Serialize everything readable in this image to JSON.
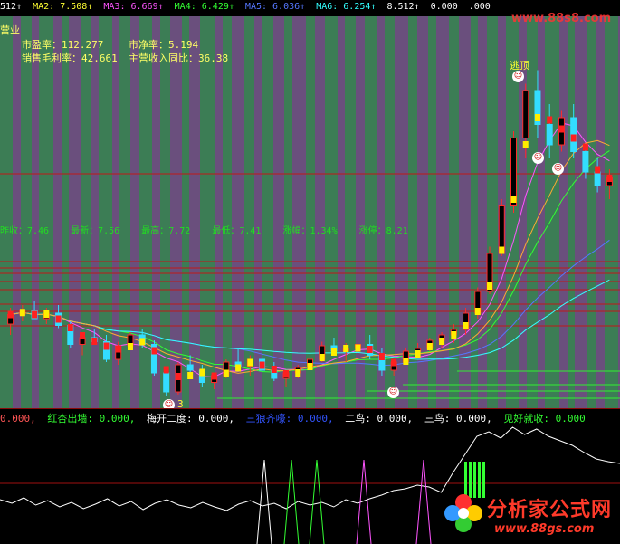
{
  "ma_row": [
    {
      "text": "512↑",
      "color": "#ffffff"
    },
    {
      "text": "MA2: 7.508↑",
      "color": "#ffff33"
    },
    {
      "text": "MA3: 6.669↑",
      "color": "#ff55ff"
    },
    {
      "text": "MA4: 6.429↑",
      "color": "#33ff33"
    },
    {
      "text": "MA5: 6.036↑",
      "color": "#5577ff"
    },
    {
      "text": "MA6: 6.254↑",
      "color": "#33ffff"
    },
    {
      "text": "8.512↑",
      "color": "#ffffff"
    },
    {
      "text": "0.000",
      "color": "#ffffff"
    },
    {
      "text": ".000",
      "color": "#ffffff"
    }
  ],
  "header_label": "营业",
  "info": {
    "pe": "市盈率：112.277",
    "pb": "市净率：5.194",
    "margin": "销售毛利率：42.661",
    "revenue_yoy": "主营收入同比：36.38"
  },
  "stats": {
    "prev_close": "昨收：7.46",
    "latest": "最新：7.56",
    "high": "最高：7.72",
    "low": "最低：7.41",
    "change": "涨幅：1.34%",
    "limit_up": "涨停：8.21"
  },
  "tip_label": "逃顶",
  "face_label": "3",
  "signals": [
    {
      "text": "0.000,",
      "color": "#ff5555"
    },
    {
      "text": "红杏出墙: 0.000,",
      "color": "#33ff33"
    },
    {
      "text": "梅开二度: 0.000,",
      "color": "#ffffff"
    },
    {
      "text": "三狼齐嚎: 0.000,",
      "color": "#3355ff"
    },
    {
      "text": "二鸟: 0.000,",
      "color": "#ffffff"
    },
    {
      "text": "三鸟: 0.000,",
      "color": "#ffffff"
    },
    {
      "text": "见好就收: 0.000",
      "color": "#33ff33"
    }
  ],
  "watermark": "www.88s8.com",
  "logo": {
    "name": "分析家公式网",
    "url": "www.88gs.com"
  },
  "colors": {
    "green_band": "#3c7d55",
    "purple_band": "#6a4f7d",
    "up_candle": "#ff2b2b",
    "down_candle": "#33ddff"
  },
  "chart_data": {
    "type": "candlestick",
    "price_range": [
      5.9,
      8.6
    ],
    "candles": [
      [
        6.48,
        6.6,
        6.4,
        6.55
      ],
      [
        6.55,
        6.62,
        6.5,
        6.58
      ],
      [
        6.58,
        6.65,
        6.52,
        6.52
      ],
      [
        6.52,
        6.6,
        6.48,
        6.56
      ],
      [
        6.56,
        6.62,
        6.45,
        6.47
      ],
      [
        6.47,
        6.5,
        6.3,
        6.33
      ],
      [
        6.33,
        6.4,
        6.25,
        6.38
      ],
      [
        6.38,
        6.44,
        6.33,
        6.35
      ],
      [
        6.35,
        6.4,
        6.2,
        6.22
      ],
      [
        6.22,
        6.35,
        6.18,
        6.32
      ],
      [
        6.32,
        6.42,
        6.3,
        6.4
      ],
      [
        6.4,
        6.44,
        6.3,
        6.33
      ],
      [
        6.33,
        6.36,
        6.1,
        6.12
      ],
      [
        6.12,
        6.16,
        5.95,
        5.98
      ],
      [
        5.98,
        6.2,
        5.96,
        6.18
      ],
      [
        6.18,
        6.25,
        6.1,
        6.14
      ],
      [
        6.14,
        6.18,
        6.02,
        6.05
      ],
      [
        6.05,
        6.12,
        6.0,
        6.1
      ],
      [
        6.1,
        6.22,
        6.08,
        6.2
      ],
      [
        6.2,
        6.3,
        6.15,
        6.17
      ],
      [
        6.17,
        6.25,
        6.1,
        6.22
      ],
      [
        6.22,
        6.26,
        6.12,
        6.14
      ],
      [
        6.14,
        6.2,
        6.06,
        6.08
      ],
      [
        6.08,
        6.14,
        6.02,
        6.12
      ],
      [
        6.12,
        6.18,
        6.08,
        6.16
      ],
      [
        6.16,
        6.25,
        6.14,
        6.22
      ],
      [
        6.22,
        6.35,
        6.2,
        6.32
      ],
      [
        6.32,
        6.38,
        6.25,
        6.28
      ],
      [
        6.28,
        6.34,
        6.2,
        6.3
      ],
      [
        6.3,
        6.36,
        6.26,
        6.33
      ],
      [
        6.33,
        6.4,
        6.22,
        6.25
      ],
      [
        6.25,
        6.3,
        6.1,
        6.14
      ],
      [
        6.14,
        6.22,
        6.1,
        6.2
      ],
      [
        6.2,
        6.3,
        6.18,
        6.28
      ],
      [
        6.28,
        6.34,
        6.24,
        6.3
      ],
      [
        6.3,
        6.38,
        6.28,
        6.36
      ],
      [
        6.36,
        6.42,
        6.3,
        6.4
      ],
      [
        6.4,
        6.48,
        6.34,
        6.44
      ],
      [
        6.44,
        6.6,
        6.4,
        6.56
      ],
      [
        6.56,
        6.75,
        6.52,
        6.72
      ],
      [
        6.72,
        7.05,
        6.7,
        7.0
      ],
      [
        7.0,
        7.4,
        6.98,
        7.35
      ],
      [
        7.35,
        7.9,
        7.3,
        7.85
      ],
      [
        7.85,
        8.25,
        7.7,
        8.2
      ],
      [
        8.2,
        8.35,
        7.85,
        7.95
      ],
      [
        7.95,
        8.1,
        7.7,
        7.8
      ],
      [
        7.8,
        8.05,
        7.75,
        8.0
      ],
      [
        8.0,
        8.1,
        7.7,
        7.75
      ],
      [
        7.75,
        7.8,
        7.55,
        7.6
      ],
      [
        7.6,
        7.7,
        7.45,
        7.5
      ],
      [
        7.5,
        7.62,
        7.4,
        7.56
      ]
    ]
  }
}
